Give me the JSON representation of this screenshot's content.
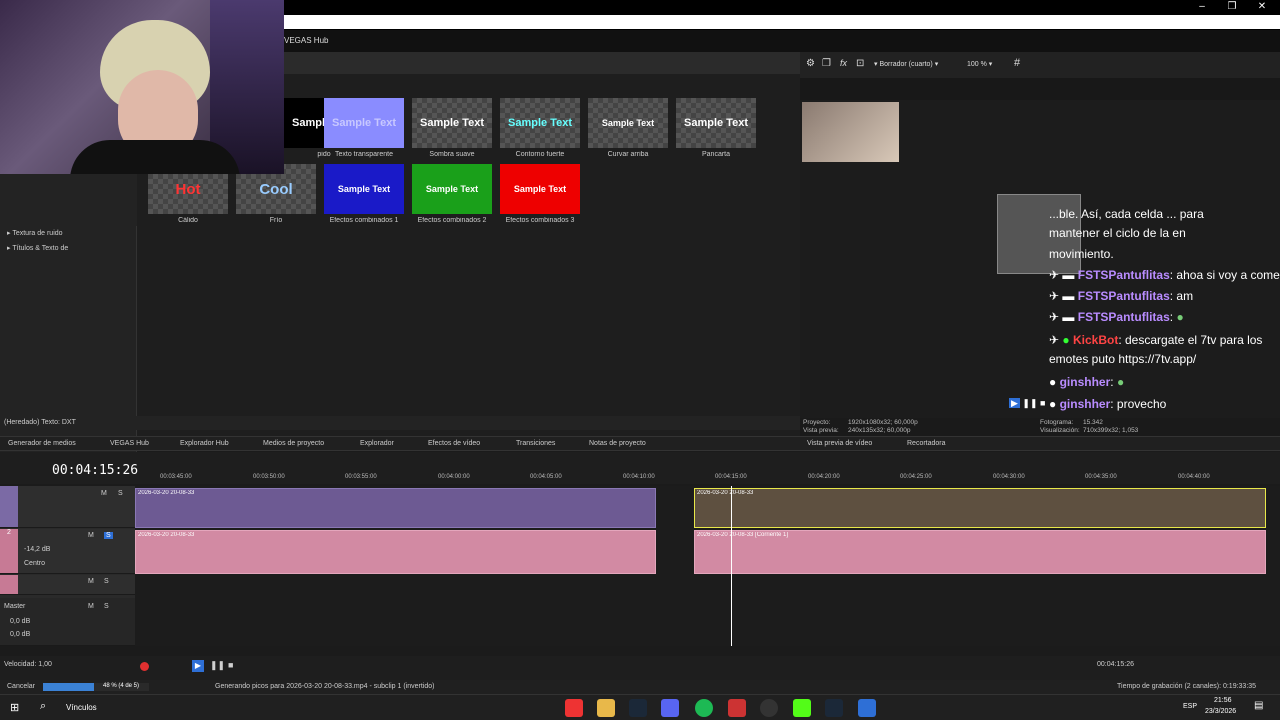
{
  "window": {
    "title_suffix": "VEGAS Hub",
    "minimize": "–",
    "maximize": "❐",
    "close": "✕"
  },
  "left_panel": {
    "tree": [
      "Textura de ruido",
      "Títulos & Texto de"
    ],
    "presets": [
      {
        "thumb": "Sample Text",
        "label": "pido",
        "style": "black"
      },
      {
        "thumb": "Sample Text",
        "label": "Texto transparente",
        "style": "violet"
      },
      {
        "thumb": "Sample Text",
        "label": "Sombra suave",
        "style": "checker"
      },
      {
        "thumb": "Sample Text",
        "label": "Contorno fuerte",
        "style": "checker-cyan"
      },
      {
        "thumb": "Sample Text",
        "label": "Curvar arriba",
        "style": "checker"
      },
      {
        "thumb": "Sample Text",
        "label": "Pancarta",
        "style": "checker"
      },
      {
        "thumb": "Hot",
        "label": "Cálido",
        "style": "hot"
      },
      {
        "thumb": "Cool",
        "label": "Frío",
        "style": "cool"
      },
      {
        "thumb": "Sample Text",
        "label": "Efectos combinados 1",
        "style": "blue"
      },
      {
        "thumb": "Sample Text",
        "label": "Efectos combinados 2",
        "style": "green"
      },
      {
        "thumb": "Sample Text",
        "label": "Efectos combinados 3",
        "style": "red"
      }
    ],
    "status": "(Heredado) Texto: DXT"
  },
  "tabs": [
    "Generador de medios",
    "VEGAS Hub",
    "Explorador Hub",
    "Medios de proyecto",
    "Explorador",
    "Efectos de vídeo",
    "Transiciones",
    "Notas de proyecto",
    "Vista previa de vídeo",
    "Recortadora"
  ],
  "preview": {
    "mode": "Borrador (cuarto)",
    "zoom": "100 %",
    "proyecto_label": "Proyecto:",
    "proyecto_value": "1920x1080x32; 60,000p",
    "vista_label": "Vista previa:",
    "vista_value": "240x135x32; 60,000p",
    "fotograma_label": "Fotograma:",
    "fotograma_value": "15.342",
    "visualizacion_label": "Visualización:",
    "visualizacion_value": "710x399x32; 1,053"
  },
  "chat": [
    {
      "name": "",
      "text": "...ble. Así, cada celda ... para"
    },
    {
      "name": "",
      "text": "mantener el ciclo de la       en"
    },
    {
      "name": "",
      "text": "movimiento."
    },
    {
      "name": "FSTSPantuflitas",
      "text": ": ahoa si voy a comer"
    },
    {
      "name": "FSTSPantuflitas",
      "text": ": am"
    },
    {
      "name": "FSTSPantuflitas",
      "text": ":"
    },
    {
      "name": "KickBot",
      "text": ": descargate el 7tv para los"
    },
    {
      "name": "",
      "text": "emotes puto https://7tv.app/"
    },
    {
      "name": "ginshher",
      "text": ":"
    },
    {
      "name": "ginshher",
      "text": ": provecho"
    }
  ],
  "timeline": {
    "timecode": "00:04:15:26",
    "ruler": [
      "00:03:45:00",
      "00:03:50:00",
      "00:03:55:00",
      "00:04:00:00",
      "00:04:05:00",
      "00:04:10:00",
      "00:04:15:00",
      "00:04:20:00",
      "00:04:25:00",
      "00:04:30:00",
      "00:04:35:00",
      "00:04:40:00"
    ],
    "track2": {
      "num": "2",
      "volume": "-14,2 dB",
      "pan": "Centro"
    },
    "master": {
      "label": "Master",
      "v1": "0,0 dB",
      "v2": "0,0 dB"
    },
    "clip_label": "2026-03-20 20-08-33",
    "audio_clip_label": "2026-03-20 20-08-33 [Corriente 1]",
    "m": "M",
    "s": "S"
  },
  "transport": {
    "speed": "Velocidad: 1,00",
    "end_time": "00:04:15:26"
  },
  "statusbar": {
    "cancel": "Cancelar",
    "progress_text": "48 % (4 de 5)",
    "progress": 0.48,
    "message": "Generando picos para 2026-03-20 20-08-33.mp4 - subclip 1 (invertido)",
    "rec_time": "Tiempo de grabación (2 canales): 0:19:33:35"
  },
  "taskbar": {
    "search": "Vínculos",
    "lang": "ESP",
    "time": "21:56",
    "date": "23/3/2026"
  }
}
